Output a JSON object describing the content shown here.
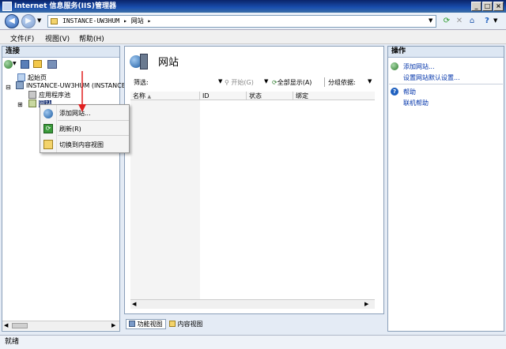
{
  "window": {
    "title": "Internet 信息服务(IIS)管理器"
  },
  "address": {
    "crumbs": [
      "INSTANCE-UW3HUM",
      "网站"
    ],
    "full": "INSTANCE-UW3HUM ▸ 网站 ▸"
  },
  "menu": {
    "items": [
      "文件(F)",
      "视图(V)",
      "帮助(H)"
    ]
  },
  "connections": {
    "header": "连接",
    "tree": {
      "start": "起始页",
      "server": "INSTANCE-UW3HUM (INSTANCE-",
      "app_pools": "应用程序池",
      "sites": "网站"
    }
  },
  "context_menu": {
    "items": [
      "添加网站...",
      "刷新(R)",
      "切换到内容视图"
    ]
  },
  "center": {
    "title": "网站",
    "filter_label": "筛选:",
    "start_label": "开始(G)",
    "show_all": "全部显示(A)",
    "group_by": "分组依据:",
    "columns": [
      "名称",
      "ID",
      "状态",
      "绑定"
    ],
    "tabs": [
      "功能视图",
      "内容视图"
    ]
  },
  "actions": {
    "header": "操作",
    "add_site": "添加网站...",
    "defaults": "设置网站默认设置...",
    "help": "帮助",
    "online_help": "联机帮助"
  },
  "status": "就绪",
  "colors": {
    "title_bar": "#0a246a",
    "link": "#0033aa",
    "arrow": "#e02020"
  }
}
